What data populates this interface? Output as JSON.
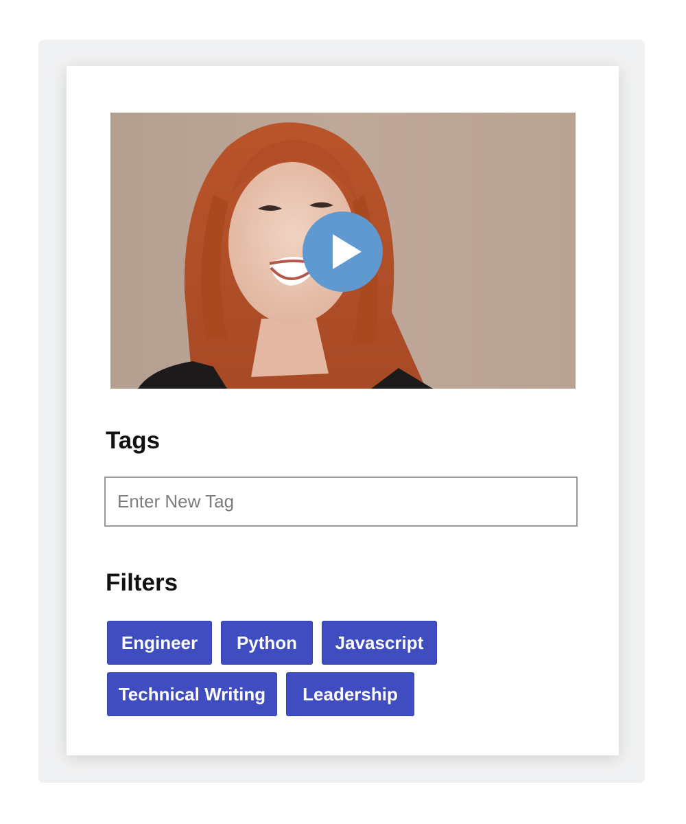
{
  "tags": {
    "title": "Tags",
    "input_placeholder": "Enter New Tag",
    "input_value": ""
  },
  "filters": {
    "title": "Filters",
    "items": [
      "Engineer",
      "Python",
      "Javascript",
      "Technical Writing",
      "Leadership"
    ]
  },
  "colors": {
    "filter_button_bg": "#3f4dc0",
    "play_button_bg": "#5f99cf",
    "card_bg": "#ffffff",
    "backdrop_bg": "#f0f1f2"
  },
  "icons": {
    "play": "play-icon"
  }
}
